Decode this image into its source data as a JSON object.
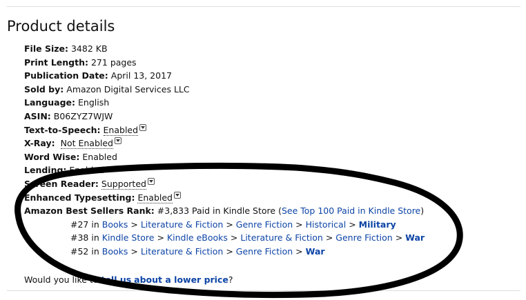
{
  "title": "Product details",
  "details": {
    "file_size": {
      "label": "File Size:",
      "value": "3482 KB"
    },
    "print_length": {
      "label": "Print Length:",
      "value": "271 pages"
    },
    "publication_date": {
      "label": "Publication Date:",
      "value": "April 13, 2017"
    },
    "sold_by": {
      "label": "Sold by:",
      "value": "Amazon Digital Services LLC"
    },
    "language": {
      "label": "Language:",
      "value": "English"
    },
    "asin": {
      "label": "ASIN:",
      "value": "B06ZYZ7WJW"
    },
    "tts": {
      "label": "Text-to-Speech:",
      "value": "Enabled"
    },
    "xray": {
      "label": "X-Ray:",
      "value": "Not Enabled"
    },
    "word_wise": {
      "label": "Word Wise:",
      "value": "Enabled"
    },
    "lending": {
      "label": "Lending:",
      "value": "Enabled"
    },
    "screen_reader": {
      "label": "Screen Reader:",
      "value": "Supported"
    },
    "typesetting": {
      "label": "Enhanced Typesetting:",
      "value": "Enabled"
    }
  },
  "rank": {
    "label": "Amazon Best Sellers Rank:",
    "value": "#3,833 Paid in Kindle Store",
    "paren_open": "(",
    "link": "See Top 100 Paid in Kindle Store",
    "paren_close": ")",
    "sep": ">",
    "in_word": "in",
    "subranks": [
      {
        "rank": "#27",
        "path": [
          "Books",
          "Literature & Fiction",
          "Genre Fiction",
          "Historical"
        ],
        "last": "Military"
      },
      {
        "rank": "#38",
        "path": [
          "Kindle Store",
          "Kindle eBooks",
          "Literature & Fiction",
          "Genre Fiction"
        ],
        "last": "War"
      },
      {
        "rank": "#52",
        "path": [
          "Books",
          "Literature & Fiction",
          "Genre Fiction"
        ],
        "last": "War"
      }
    ]
  },
  "feedback": {
    "prefix": "Would you like to",
    "link1": "tell us",
    "link2": "about a lower price",
    "suffix": "?"
  },
  "colors": {
    "link": "#0d44a6",
    "annotation": "#000000"
  }
}
